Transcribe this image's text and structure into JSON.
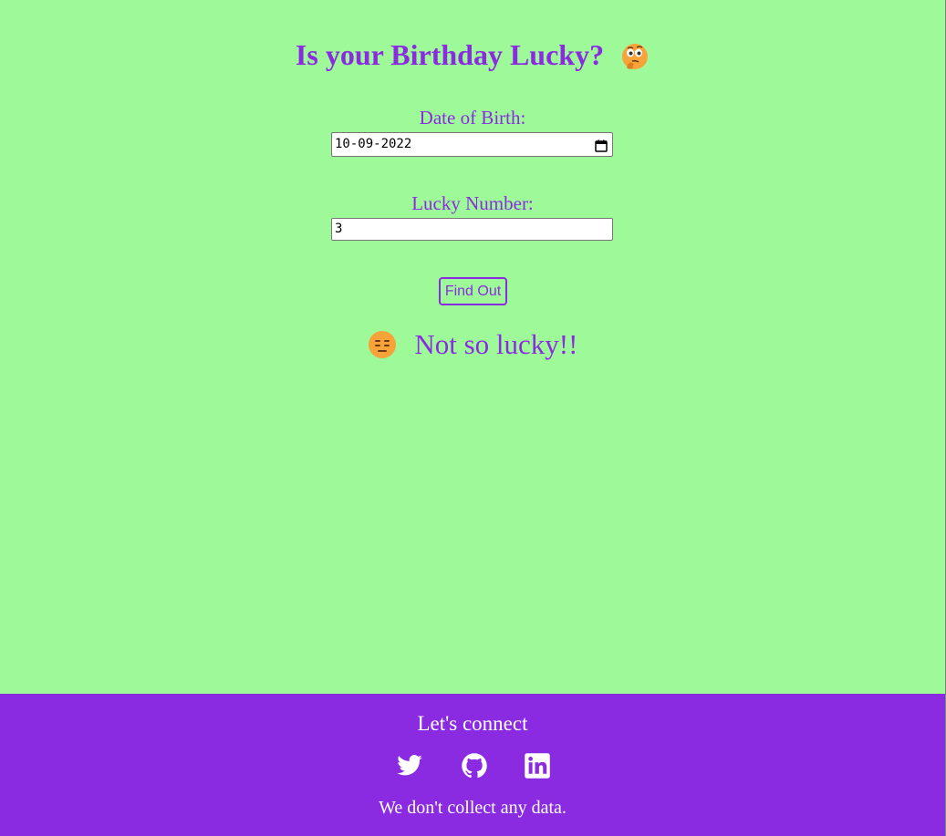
{
  "title": "Is your Birthday Lucky?",
  "form": {
    "dob_label": "Date of Birth:",
    "dob_value": "10-09-2022",
    "lucky_label": "Lucky Number:",
    "lucky_value": "3",
    "submit_label": "Find Out"
  },
  "result": {
    "message": "Not so lucky!!",
    "icon": "expressionless-face-icon"
  },
  "footer": {
    "heading": "Let's connect",
    "note": "We don't collect any data.",
    "social": [
      "twitter-icon",
      "github-icon",
      "linkedin-icon"
    ]
  },
  "colors": {
    "background": "#9efa98",
    "accent": "#8a2be2",
    "footer_text": "#ffffff"
  }
}
